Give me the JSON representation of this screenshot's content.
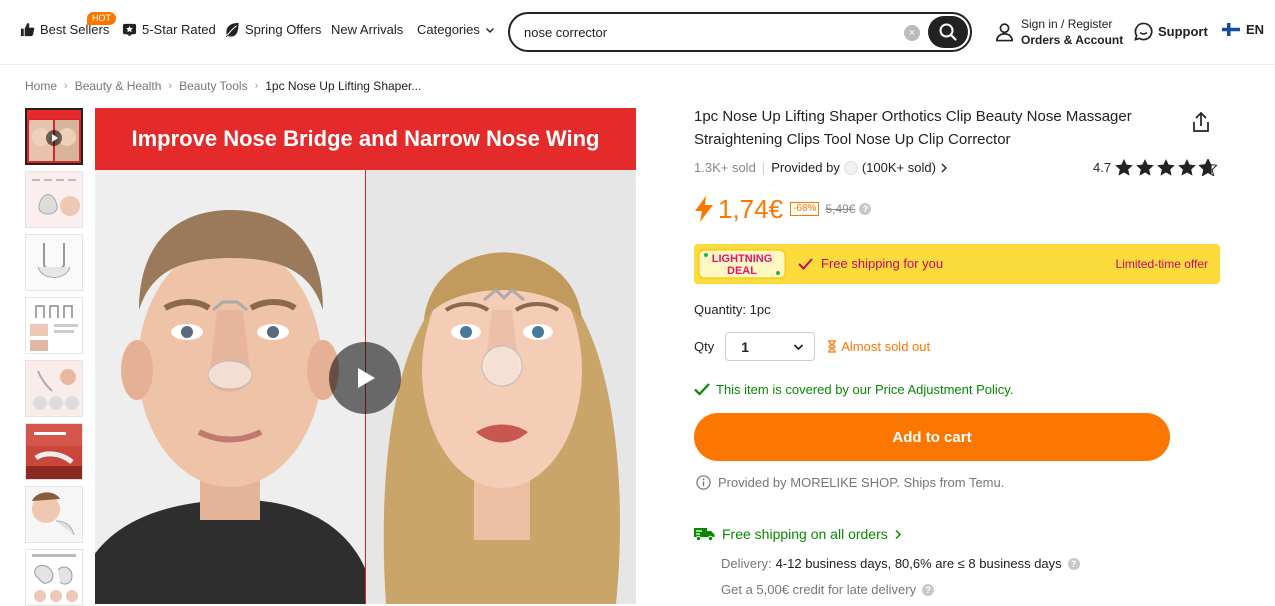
{
  "header": {
    "nav": [
      {
        "label": "Best Sellers",
        "icon": "thumbs-up-icon",
        "badge": "HOT"
      },
      {
        "label": "5-Star Rated",
        "icon": "star-badge-icon"
      },
      {
        "label": "Spring Offers",
        "icon": "leaf-icon"
      },
      {
        "label": "New Arrivals"
      },
      {
        "label": "Categories",
        "icon": "chevron-down-icon"
      }
    ],
    "search": {
      "value": "nose corrector",
      "clear_icon": "clear-icon",
      "button_icon": "search-icon"
    },
    "account": {
      "line1": "Sign in / Register",
      "line2": "Orders & Account",
      "icon": "user-icon"
    },
    "support": {
      "label": "Support",
      "icon": "chat-icon"
    },
    "language": {
      "label": "EN",
      "icon": "finland-flag-icon"
    }
  },
  "breadcrumb": [
    "Home",
    "Beauty & Health",
    "Beauty Tools",
    "1pc Nose Up Lifting Shaper..."
  ],
  "gallery": {
    "thumbnail_count": 8,
    "main_image_banner": "Improve Nose Bridge and Narrow Nose Wing",
    "play_icon": "play-icon"
  },
  "product": {
    "title": "1pc Nose Up Lifting Shaper Orthotics Clip Beauty Nose Massager Straightening Clips Tool Nose Up Clip Corrector",
    "sold": "1.3K+ sold",
    "provided_by": "Provided by",
    "shop_sold": "(100K+ sold)",
    "rating": "4.7",
    "rating_value": 4.7,
    "price": "1,74€",
    "discount": "-68%",
    "old_price": "5,49€",
    "deal": {
      "logo_line1": "LIGHTNING",
      "logo_line2": "DEAL",
      "shipping": "Free shipping for you",
      "limited": "Limited-time offer"
    },
    "quantity_label": "Quantity: 1pc",
    "qty_label": "Qty",
    "qty_value": "1",
    "almost_sold_out": "Almost sold out",
    "policy": "This item is covered by our Price Adjustment Policy.",
    "add_to_cart": "Add to cart",
    "provided_note": "Provided by MORELIKE SHOP. Ships from Temu.",
    "free_shipping": "Free shipping on all orders",
    "delivery_label": "Delivery:",
    "delivery_value": "4-12 business days, 80,6% are ≤ 8 business days",
    "credit": "Get a 5,00€ credit for late delivery"
  },
  "colors": {
    "accent": "#fb7701",
    "deal_bg": "#fcdb3c",
    "deal_text": "#c50a6b",
    "success": "#0a8800"
  }
}
